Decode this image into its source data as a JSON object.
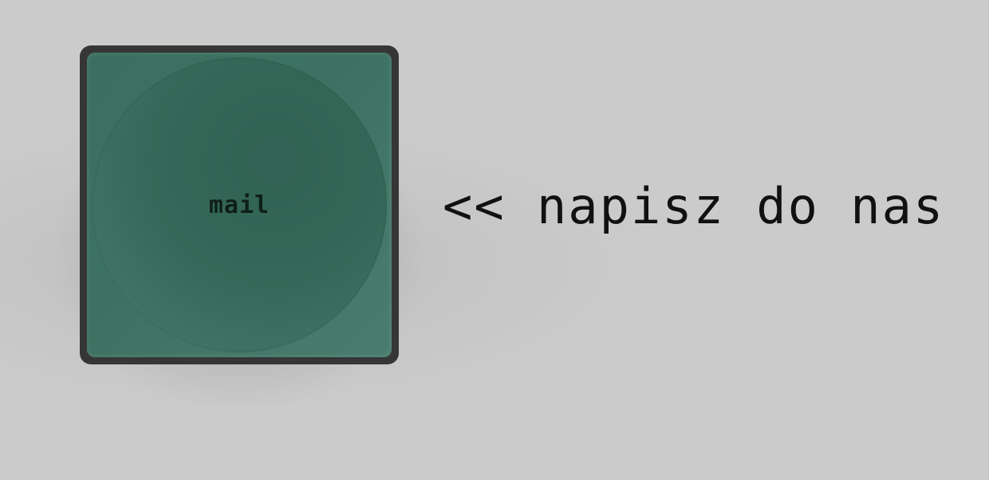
{
  "button": {
    "label": "mail",
    "face_color": "#3d7262",
    "frame_color": "#363636"
  },
  "hint": {
    "text": "<< napisz do nas"
  },
  "colors": {
    "background": "#cbcbcb",
    "text": "#111111"
  }
}
